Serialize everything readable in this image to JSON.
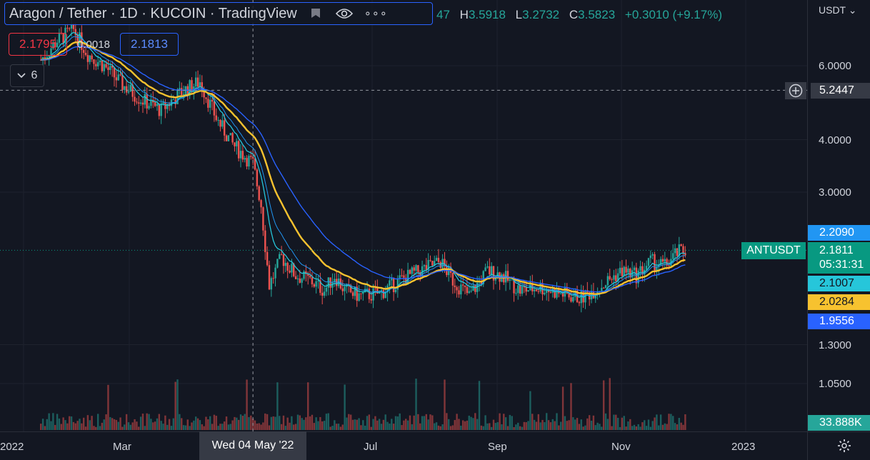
{
  "header": {
    "symbol_title": "Aragon / Tether · 1D · KUCOIN · TradingView",
    "ohlc_tail": "47",
    "high_label": "H",
    "high_value": "3.5918",
    "low_label": "L",
    "low_value": "3.2732",
    "close_label": "C",
    "close_value": "3.5823",
    "change": "+0.3010 (+9.17%)",
    "more_label": "∘∘∘"
  },
  "indicator_pills": {
    "value_red": "2.1795",
    "value_mid": "0.0018",
    "value_blue": "2.1813",
    "collapse_count": "6"
  },
  "price_axis": {
    "currency": "USDT",
    "ticks": [
      "6.0000",
      "4.0000",
      "3.0000",
      "1.3000",
      "1.0500"
    ],
    "crosshair_price": "5.2447",
    "symbol_tag": "ANTUSDT",
    "last_price": "2.1811",
    "countdown": "05:31:31",
    "volume_label": "33.888K"
  },
  "ema_labels": {
    "ema_a": "2.2090",
    "ema_b": "2.1007",
    "ema_c": "2.0284",
    "ema_d": "1.9556"
  },
  "time_axis": {
    "ticks": [
      "2022",
      "Mar",
      "Jul",
      "Sep",
      "Nov",
      "2023"
    ],
    "crosshair_date": "Wed 04 May '22"
  },
  "colors": {
    "up": "#26a69a",
    "down": "#ef5350",
    "ema_a": "#2196f3",
    "ema_b": "#26c6da",
    "ema_c": "#f7c22f",
    "ema_d": "#2962ff"
  },
  "chart_data": {
    "type": "candlestick",
    "symbol": "ANTUSDT",
    "exchange": "KUCOIN",
    "interval": "1D",
    "scale": "log",
    "x": [
      "2022-01-20",
      "2022-01-28",
      "2022-02-05",
      "2022-02-12",
      "2022-02-20",
      "2022-03-01",
      "2022-03-10",
      "2022-03-20",
      "2022-03-30",
      "2022-04-08",
      "2022-04-16",
      "2022-04-24",
      "2022-05-04",
      "2022-05-08",
      "2022-05-12",
      "2022-05-18",
      "2022-05-25",
      "2022-06-01",
      "2022-06-08",
      "2022-06-13",
      "2022-06-18",
      "2022-06-25",
      "2022-07-05",
      "2022-07-15",
      "2022-07-25",
      "2022-08-04",
      "2022-08-10",
      "2022-08-18",
      "2022-08-27",
      "2022-09-03",
      "2022-09-12",
      "2022-09-22",
      "2022-10-02",
      "2022-10-12",
      "2022-10-22",
      "2022-11-01",
      "2022-11-08",
      "2022-11-15",
      "2022-11-22",
      "2022-11-28",
      "2022-12-02"
    ],
    "close": [
      6.2,
      6.9,
      7.3,
      6.4,
      6.0,
      5.4,
      5.0,
      4.7,
      5.2,
      5.5,
      4.5,
      3.9,
      3.5,
      2.8,
      1.8,
      2.1,
      1.9,
      1.85,
      1.75,
      1.9,
      1.75,
      1.7,
      1.72,
      1.85,
      1.95,
      2.05,
      1.85,
      1.7,
      1.95,
      1.9,
      1.75,
      1.78,
      1.72,
      1.68,
      1.8,
      1.95,
      1.9,
      2.05,
      2.0,
      2.15,
      2.18
    ],
    "ema_values": {
      "ema_a": 2.209,
      "ema_b": 2.1007,
      "ema_c": 2.0284,
      "ema_d": 1.9556
    },
    "last_price": 2.1811,
    "volume_last": "33.888K",
    "y_ticks": [
      6.0,
      4.0,
      3.0,
      1.3,
      1.05
    ],
    "x_ticks": [
      "2022",
      "Mar",
      "Jul",
      "Sep",
      "Nov",
      "2023"
    ]
  }
}
